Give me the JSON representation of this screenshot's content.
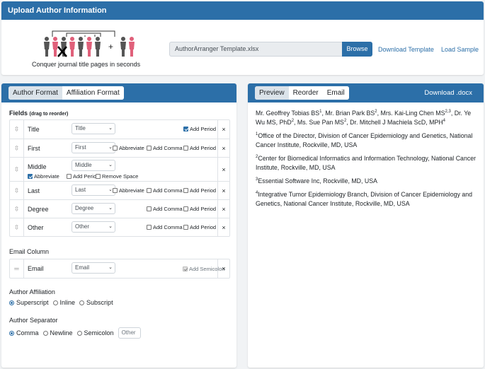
{
  "upload": {
    "title": "Upload Author Information",
    "tagline": "Conquer journal title pages in seconds",
    "file_value": "AuthorArranger Template.xlsx",
    "browse_label": "Browse",
    "download_template": "Download Template",
    "load_sample": "Load Sample"
  },
  "left": {
    "tabs": [
      "Author Format",
      "Affiliation Format"
    ],
    "fields_label": "Fields",
    "fields_hint": "(drag to reorder)",
    "fields": [
      {
        "name": "Title",
        "select": "Title",
        "opts": [
          {
            "label": "Add Period",
            "checked": true
          }
        ]
      },
      {
        "name": "First",
        "select": "First",
        "opts": [
          {
            "label": "Abbreviate",
            "checked": false
          },
          {
            "label": "Add Comma",
            "checked": false
          },
          {
            "label": "Add Period",
            "checked": false
          }
        ]
      },
      {
        "name": "Middle",
        "select": "Middle",
        "opts": [
          {
            "label": "Abbreviate",
            "checked": true
          },
          {
            "label": "Add Period",
            "checked": false
          },
          {
            "label": "Remove Space",
            "checked": false
          }
        ]
      },
      {
        "name": "Last",
        "select": "Last",
        "opts": [
          {
            "label": "Abbreviate",
            "checked": false
          },
          {
            "label": "Add Comma",
            "checked": false
          },
          {
            "label": "Add Period",
            "checked": false
          }
        ]
      },
      {
        "name": "Degree",
        "select": "Degree",
        "opts": [
          {
            "label": "Add Comma",
            "checked": false
          },
          {
            "label": "Add Period",
            "checked": false
          }
        ]
      },
      {
        "name": "Other",
        "select": "Other",
        "opts": [
          {
            "label": "Add Comma",
            "checked": false
          },
          {
            "label": "Add Period",
            "checked": false
          }
        ]
      }
    ],
    "email_column_label": "Email Column",
    "email_field": {
      "name": "Email",
      "select": "Email",
      "opt": "Add Semicolon"
    },
    "remove_symbol": "×",
    "affiliation_label": "Author Affiliation",
    "affiliation_options": [
      "Superscript",
      "Inline",
      "Subscript"
    ],
    "separator_label": "Author Separator",
    "separator_options": [
      "Comma",
      "Newline",
      "Semicolon"
    ],
    "separator_other_placeholder": "Other"
  },
  "right": {
    "tabs": [
      "Preview",
      "Reorder",
      "Email"
    ],
    "download_docx": "Download .docx",
    "authors": [
      {
        "name": "Mr. Geoffrey Tobias BS",
        "sup": "1",
        "sep": ", "
      },
      {
        "name": "Mr. Brian Park BS",
        "sup": "2",
        "sep": ", "
      },
      {
        "name": "Mrs. Kai-Ling Chen MS",
        "sup": "2,3",
        "sep": ", "
      },
      {
        "name": "Dr. Ye Wu MS, PhD",
        "sup": "2",
        "sep": ", "
      },
      {
        "name": "Ms. Sue Pan MS",
        "sup": "2",
        "sep": ", "
      },
      {
        "name": "Dr. Mitchell J Machiela ScD, MPH",
        "sup": "4",
        "sep": ""
      }
    ],
    "affiliations": [
      {
        "num": "1",
        "text": "Office of the Director, Division of Cancer Epidemiology and Genetics, National Cancer Institute, Rockville, MD, USA"
      },
      {
        "num": "2",
        "text": "Center for Biomedical Informatics and Information Technology, National Cancer Institute, Rockville, MD, USA"
      },
      {
        "num": "3",
        "text": "Essential Software Inc, Rockville, MD, USA"
      },
      {
        "num": "4",
        "text": "Integrative Tumor Epidemiology Branch, Division of Cancer Epidemiology and Genetics, National Cancer Institute, Rockville, MD, USA"
      }
    ]
  },
  "colors": {
    "brand": "#2c6fa8",
    "figure_dark": "#555555",
    "figure_pink": "#e0607a"
  }
}
